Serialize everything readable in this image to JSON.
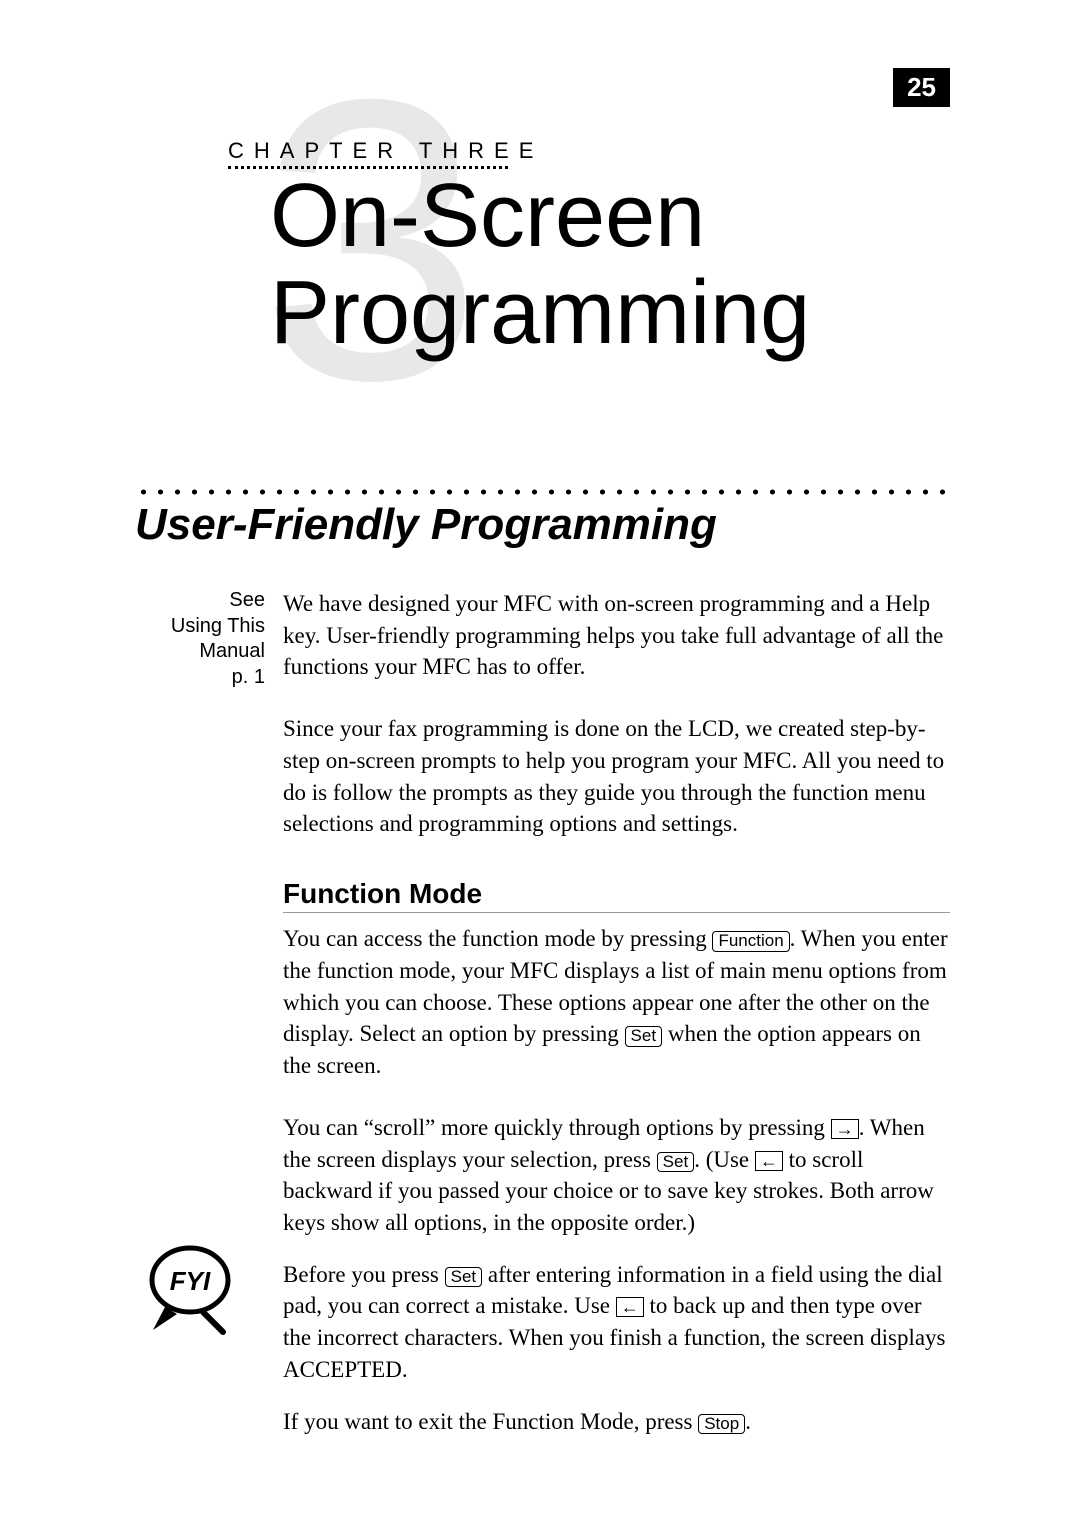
{
  "page_number": "25",
  "chapter": {
    "big_number": "3",
    "label": "CHAPTER THREE",
    "title_line1": "On-Screen",
    "title_line2": "Programming"
  },
  "section": {
    "title": "User-Friendly Programming"
  },
  "sidebar": {
    "line1": "See",
    "line2": "Using This",
    "line3": "Manual",
    "line4": "p. 1"
  },
  "body": {
    "p1": "We have designed your MFC with on-screen programming and a Help key. User-friendly programming helps you take full advantage of all the functions your MFC has to offer.",
    "p2": "Since your fax programming is done on the LCD, we created step-by-step on-screen prompts to help you program your MFC.  All you need to do is follow the prompts as they guide you through the function menu selections and programming options and settings."
  },
  "subsection": {
    "title": "Function Mode",
    "p1_a": "You can access the function mode by pressing ",
    "p1_b": ". When you enter the function mode, your MFC displays a list of main menu options from which you can choose. These options appear one after the other on the display. Select an option by pressing ",
    "p1_c": " when the option appears on the screen.",
    "p2_a": "You can “scroll” more quickly through options by pressing ",
    "p2_b": ". When the screen displays your selection, press ",
    "p2_c": ". (Use ",
    "p2_d": " to scroll backward if you passed your choice or to save key strokes. Both arrow keys show all options, in the opposite order.)",
    "p3_a": "Before you press ",
    "p3_b": " after entering information in a field using the dial pad, you can correct a mistake. Use ",
    "p3_c": " to back up and then type over the incorrect characters. When you finish a function, the screen displays ACCEPTED.",
    "p4_a": "If you want to exit the Function Mode, press ",
    "p4_b": "."
  },
  "keys": {
    "function": "Function",
    "set": "Set",
    "stop": "Stop",
    "right_arrow": "→",
    "left_arrow": "←"
  },
  "fyi_label": "FYI"
}
